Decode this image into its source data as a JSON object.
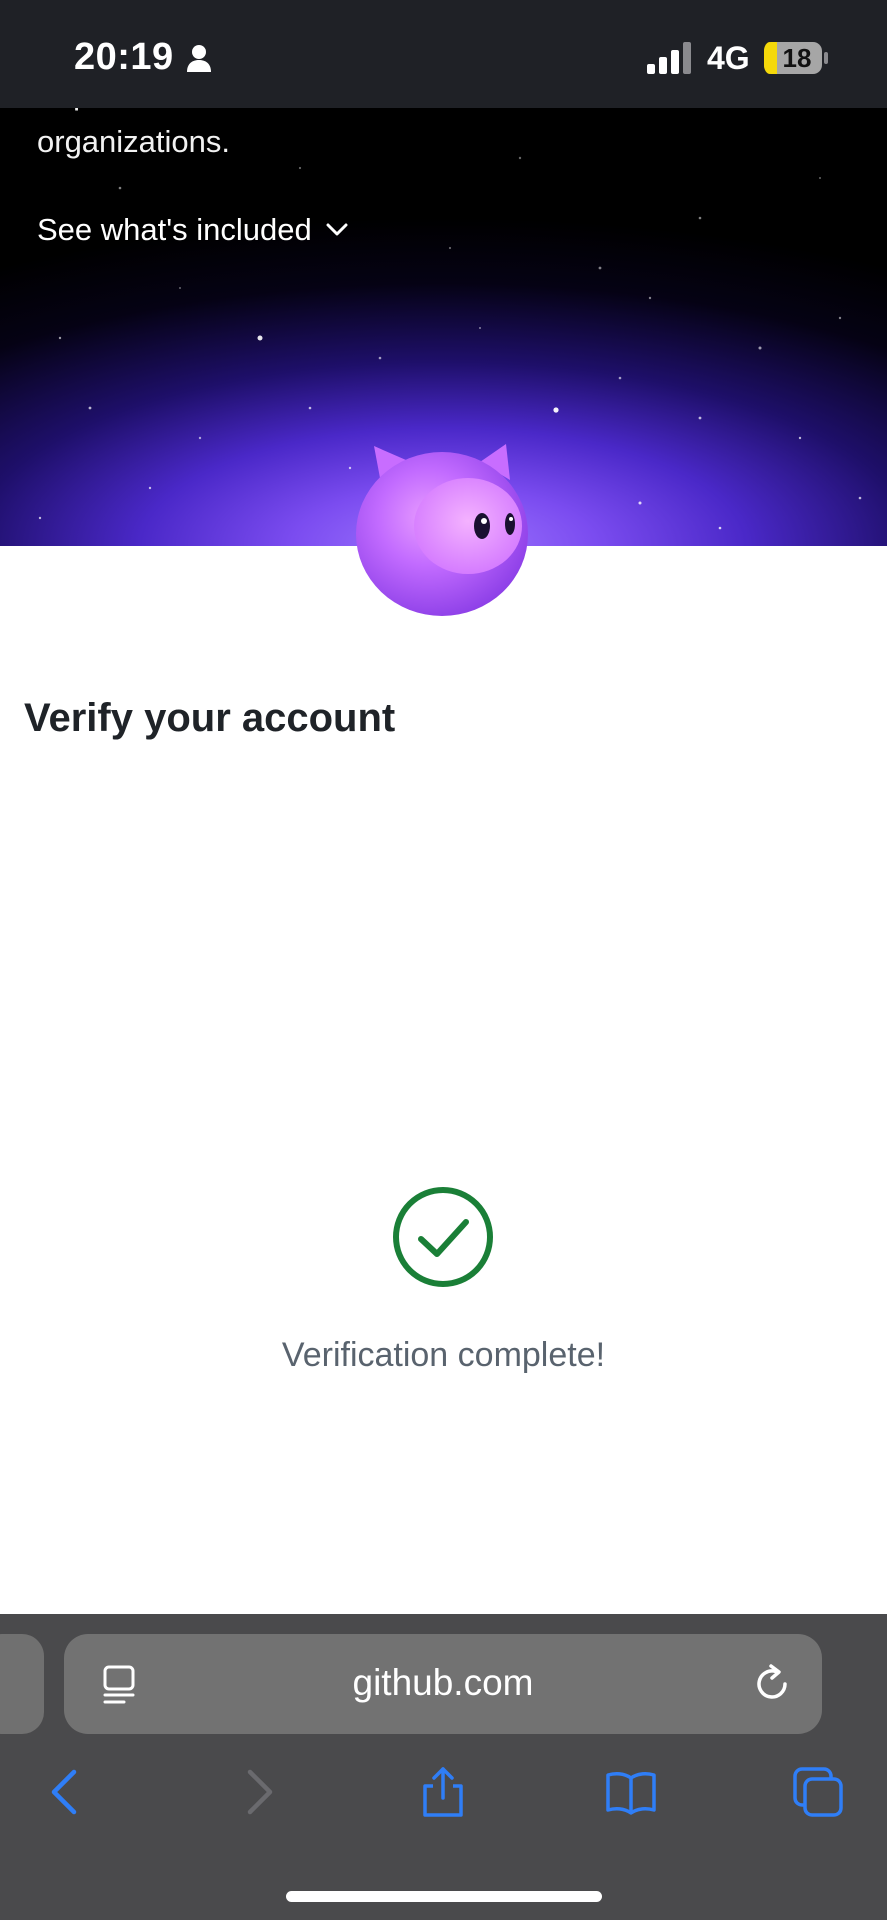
{
  "status_bar": {
    "time": "20:19",
    "network": "4G",
    "battery": "18",
    "battery_color": "#f5d90a",
    "icons": [
      "person-icon",
      "signal-icon",
      "battery-icon"
    ]
  },
  "hero": {
    "description": "Explore GitHub's core features for individuals and organizations.",
    "toggle_label": "See what's included",
    "toggle_icon": "chevron-down-icon"
  },
  "main": {
    "title": "Verify your account",
    "status_text": "Verification complete!",
    "status_icon": "check-circle-icon",
    "success_color": "#1a7f37"
  },
  "browser": {
    "url": "github.com",
    "icons": [
      "reader-icon",
      "reload-icon",
      "back-icon",
      "forward-icon",
      "share-icon",
      "bookmarks-icon",
      "tabs-icon"
    ],
    "accent_color": "#2f7ef7"
  }
}
